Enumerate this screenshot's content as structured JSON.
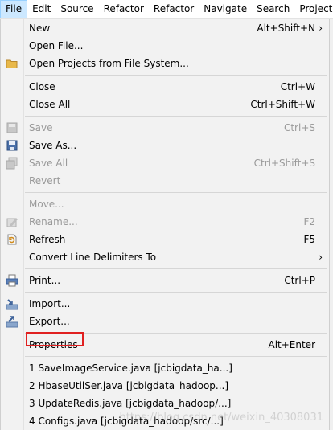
{
  "menubar": {
    "items": [
      "File",
      "Edit",
      "Source",
      "Refactor",
      "Refactor",
      "Navigate",
      "Search",
      "Project"
    ]
  },
  "menu": {
    "new": {
      "label": "New",
      "accel": "Alt+Shift+N"
    },
    "open_file": {
      "label": "Open File..."
    },
    "open_projects": {
      "label": "Open Projects from File System..."
    },
    "close": {
      "label": "Close",
      "accel": "Ctrl+W"
    },
    "close_all": {
      "label": "Close All",
      "accel": "Ctrl+Shift+W"
    },
    "save": {
      "label": "Save",
      "accel": "Ctrl+S"
    },
    "save_as": {
      "label": "Save As..."
    },
    "save_all": {
      "label": "Save All",
      "accel": "Ctrl+Shift+S"
    },
    "revert": {
      "label": "Revert"
    },
    "move": {
      "label": "Move..."
    },
    "rename": {
      "label": "Rename...",
      "accel": "F2"
    },
    "refresh": {
      "label": "Refresh",
      "accel": "F5"
    },
    "convert": {
      "label": "Convert Line Delimiters To"
    },
    "print": {
      "label": "Print...",
      "accel": "Ctrl+P"
    },
    "import": {
      "label": "Import..."
    },
    "export": {
      "label": "Export..."
    },
    "properties": {
      "label": "Properties",
      "accel": "Alt+Enter"
    },
    "recent": [
      "1 SaveImageService.java  [jcbigdata_ha...]",
      "2 HbaseUtilSer.java  [jcbigdata_hadoop...]",
      "3 UpdateRedis.java  [jcbigdata_hadoop/...]",
      "4 Configs.java  [jcbigdata_hadoop/src/...]"
    ]
  },
  "watermark": "https://blog.csdn.net/weixin_40308031",
  "colors": {
    "highlight_border": "#e02020",
    "menubar_active": "#cce8ff"
  }
}
